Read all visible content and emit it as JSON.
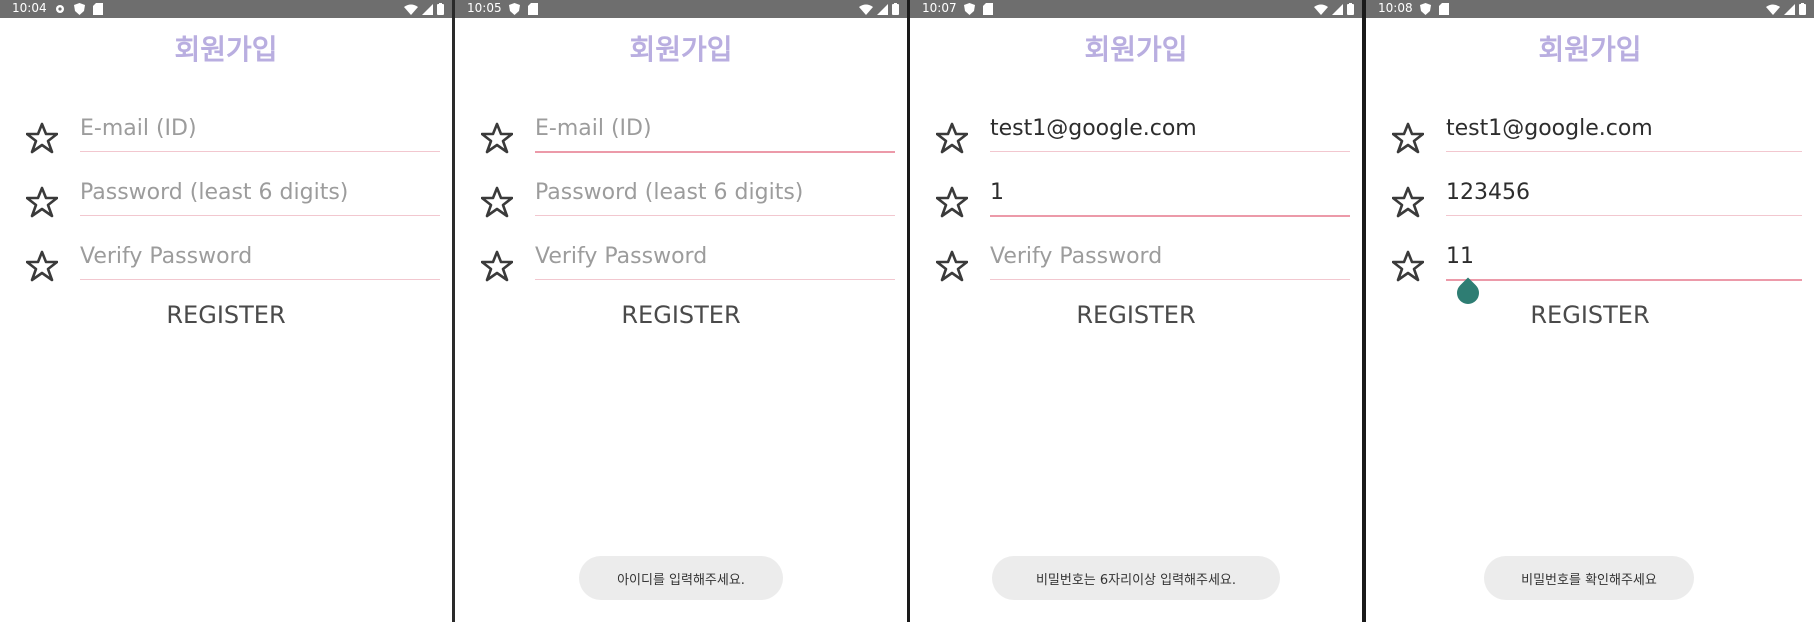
{
  "screens": [
    {
      "time": "10:04",
      "title": "회원가입",
      "email": {
        "value": "",
        "placeholder": "E-mail (ID)"
      },
      "password": {
        "value": "",
        "placeholder": "Password (least 6 digits)"
      },
      "verify": {
        "value": "",
        "placeholder": "Verify Password"
      },
      "register_label": "REGISTER",
      "toast": ""
    },
    {
      "time": "10:05",
      "title": "회원가입",
      "email": {
        "value": "",
        "placeholder": "E-mail (ID)"
      },
      "password": {
        "value": "",
        "placeholder": "Password (least 6 digits)"
      },
      "verify": {
        "value": "",
        "placeholder": "Verify Password"
      },
      "register_label": "REGISTER",
      "toast": "아이디를 입력해주세요."
    },
    {
      "time": "10:07",
      "title": "회원가입",
      "email": {
        "value": "test1@google.com",
        "placeholder": "E-mail (ID)"
      },
      "password": {
        "value": "1",
        "placeholder": "Password (least 6 digits)"
      },
      "verify": {
        "value": "",
        "placeholder": "Verify Password"
      },
      "register_label": "REGISTER",
      "toast": "비밀번호는 6자리이상 입력해주세요."
    },
    {
      "time": "10:08",
      "title": "회원가입",
      "email": {
        "value": "test1@google.com",
        "placeholder": "E-mail (ID)"
      },
      "password": {
        "value": "123456",
        "placeholder": "Password (least 6 digits)"
      },
      "verify": {
        "value": "11",
        "placeholder": "Verify Password"
      },
      "register_label": "REGISTER",
      "toast": "비밀번호를 확인해주세요"
    }
  ],
  "colors": {
    "title": "#b9aee0",
    "underline": "#f2c7cf",
    "underline_active": "#ec9aa9",
    "statusbar": "#6e6e6e",
    "toast_bg": "#ececec",
    "cursor_handle": "#2e7d73"
  },
  "icons": {
    "field_icon": "star-outline-icon",
    "status_left": [
      "settings-icon",
      "shield-icon",
      "sd-card-icon"
    ],
    "status_right": [
      "wifi-icon",
      "signal-icon",
      "battery-icon"
    ]
  }
}
